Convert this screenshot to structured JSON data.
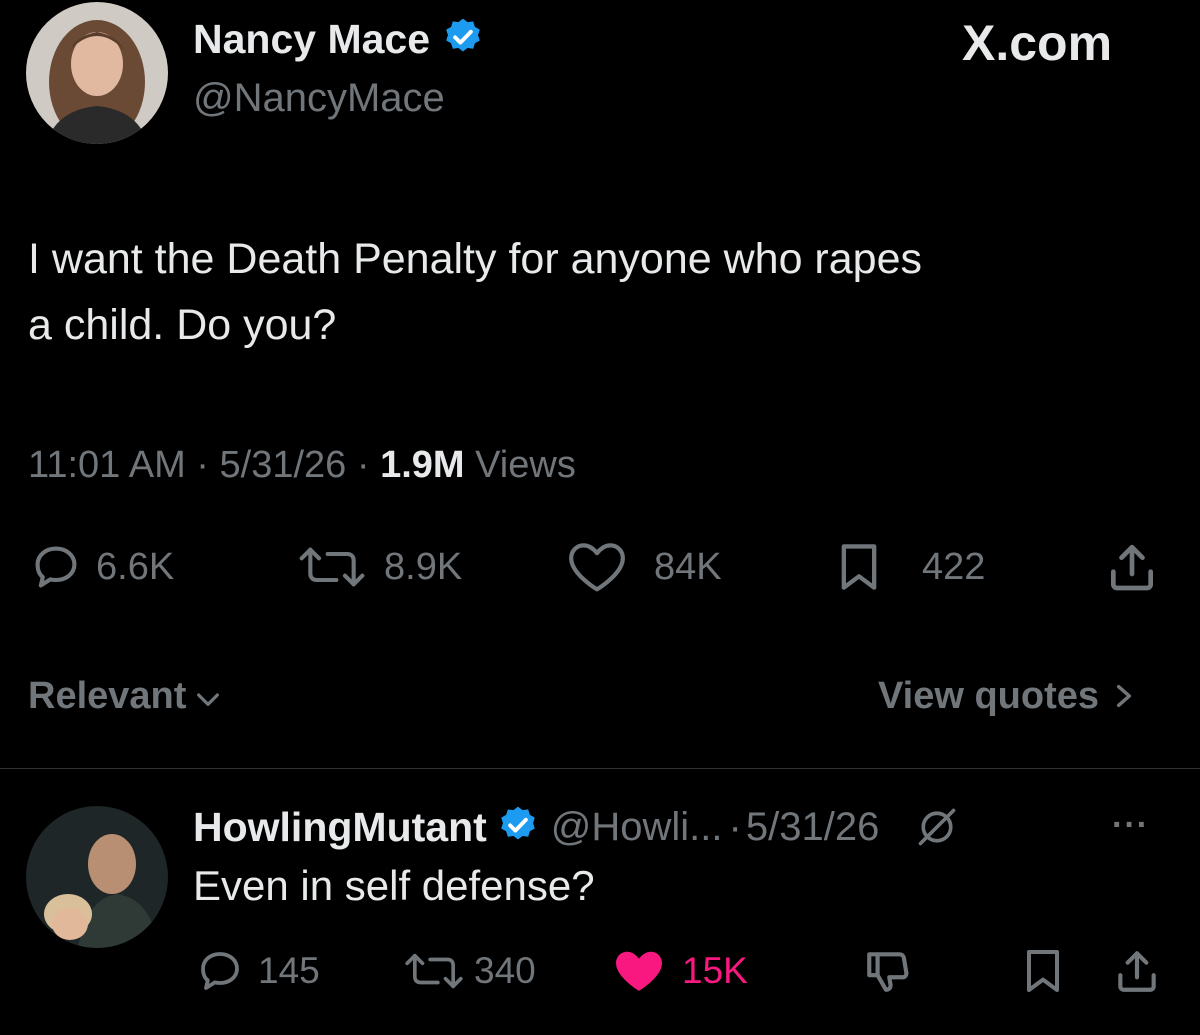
{
  "watermark": "X.com",
  "tweet": {
    "author_name": "Nancy Mace",
    "author_handle": "@NancyMace",
    "text_line1": "I want the Death Penalty for anyone who rapes",
    "text_line2": "a child. Do you?",
    "time": "11:01 AM",
    "sep": "·",
    "date": "5/31/26",
    "views_count": "1.9M",
    "views_label": "Views",
    "replies": "6.6K",
    "reposts": "8.9K",
    "likes": "84K",
    "bookmarks": "422"
  },
  "sort": {
    "label": "Relevant",
    "chevron": "chevron-down-icon",
    "quotes_label": "View quotes",
    "quotes_chevron": ">"
  },
  "reply": {
    "author_name": "HowlingMutant",
    "author_handle": "@Howli...",
    "sep": "·",
    "date": "5/31/26",
    "text": "Even in self defense?",
    "replies": "145",
    "reposts": "340",
    "likes": "15K",
    "more": "···"
  },
  "colors": {
    "background": "#000000",
    "verified": "#1d9bf0",
    "like_active": "#f91880",
    "muted": "#71767b"
  }
}
